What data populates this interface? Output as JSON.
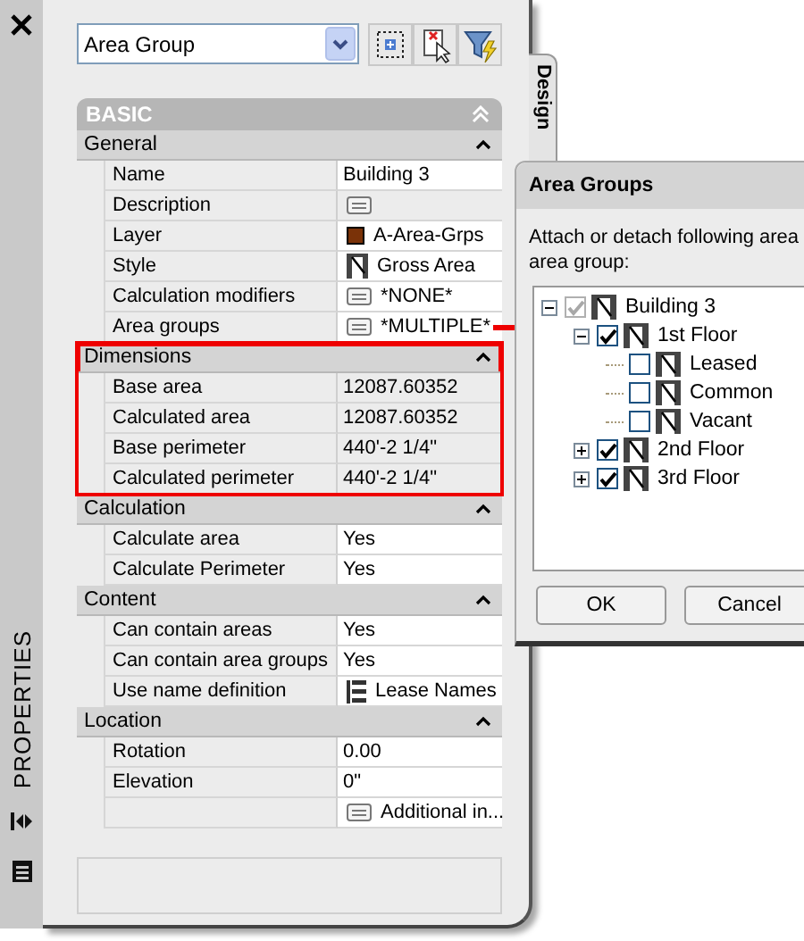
{
  "palette": {
    "title": "PROPERTIES",
    "side_tab": "Design"
  },
  "toolbar": {
    "selector": {
      "value": "Area Group"
    }
  },
  "category": {
    "title": "BASIC",
    "expanded": true
  },
  "sections": [
    {
      "title": "General",
      "expanded": true,
      "highlighted": false,
      "rows": [
        {
          "label": "Name",
          "value": "Building 3",
          "editable": true
        },
        {
          "label": "Description",
          "kind": "note",
          "editable": false
        },
        {
          "label": "Layer",
          "value": "A-Area-Grps",
          "kind": "swatch",
          "color": "#7a3208",
          "editable": true
        },
        {
          "label": "Style",
          "value": "Gross Area",
          "kind": "style",
          "editable": true
        },
        {
          "label": "Calculation modifiers",
          "value": "*NONE*",
          "kind": "note",
          "editable": true
        },
        {
          "label": "Area groups",
          "value": "*MULTIPLE*",
          "kind": "note",
          "editable": true
        }
      ]
    },
    {
      "title": "Dimensions",
      "expanded": true,
      "highlighted": true,
      "rows": [
        {
          "label": "Base area",
          "value": "12087.60352",
          "editable": false
        },
        {
          "label": "Calculated area",
          "value": "12087.60352",
          "editable": false
        },
        {
          "label": "Base perimeter",
          "value": "440'-2 1/4\"",
          "editable": false
        },
        {
          "label": "Calculated perimeter",
          "value": "440'-2 1/4\"",
          "editable": false
        }
      ]
    },
    {
      "title": "Calculation",
      "expanded": true,
      "highlighted": false,
      "rows": [
        {
          "label": "Calculate area",
          "value": "Yes",
          "editable": true
        },
        {
          "label": "Calculate Perimeter",
          "value": "Yes",
          "editable": true
        }
      ]
    },
    {
      "title": "Content",
      "expanded": true,
      "highlighted": false,
      "rows": [
        {
          "label": "Can contain areas",
          "value": "Yes",
          "editable": true
        },
        {
          "label": "Can contain area groups",
          "value": "Yes",
          "editable": true
        },
        {
          "label": "Use name definition",
          "value": "Lease Names",
          "kind": "list",
          "editable": true
        }
      ]
    },
    {
      "title": "Location",
      "expanded": true,
      "highlighted": false,
      "rows": [
        {
          "label": "Rotation",
          "value": "0.00",
          "editable": true
        },
        {
          "label": "Elevation",
          "value": "0\"",
          "editable": true
        },
        {
          "value": "Additional in...",
          "kind": "note",
          "editable": true
        }
      ]
    }
  ],
  "dialog": {
    "title": "Area Groups",
    "text_lines": [
      "Attach or detach following area",
      "area group:"
    ],
    "tree": [
      {
        "label": "Building 3",
        "checked": true,
        "disabled": true,
        "expanded": true,
        "children": [
          {
            "label": "1st Floor",
            "checked": true,
            "disabled": false,
            "expanded": true,
            "children": [
              {
                "label": "Leased",
                "checked": false,
                "disabled": false
              },
              {
                "label": "Common",
                "checked": false,
                "disabled": false
              },
              {
                "label": "Vacant",
                "checked": false,
                "disabled": false
              }
            ]
          },
          {
            "label": "2nd Floor",
            "checked": true,
            "disabled": false,
            "expanded": false
          },
          {
            "label": "3rd Floor",
            "checked": true,
            "disabled": false,
            "expanded": false
          }
        ]
      }
    ],
    "buttons": [
      "OK",
      "Cancel"
    ]
  }
}
